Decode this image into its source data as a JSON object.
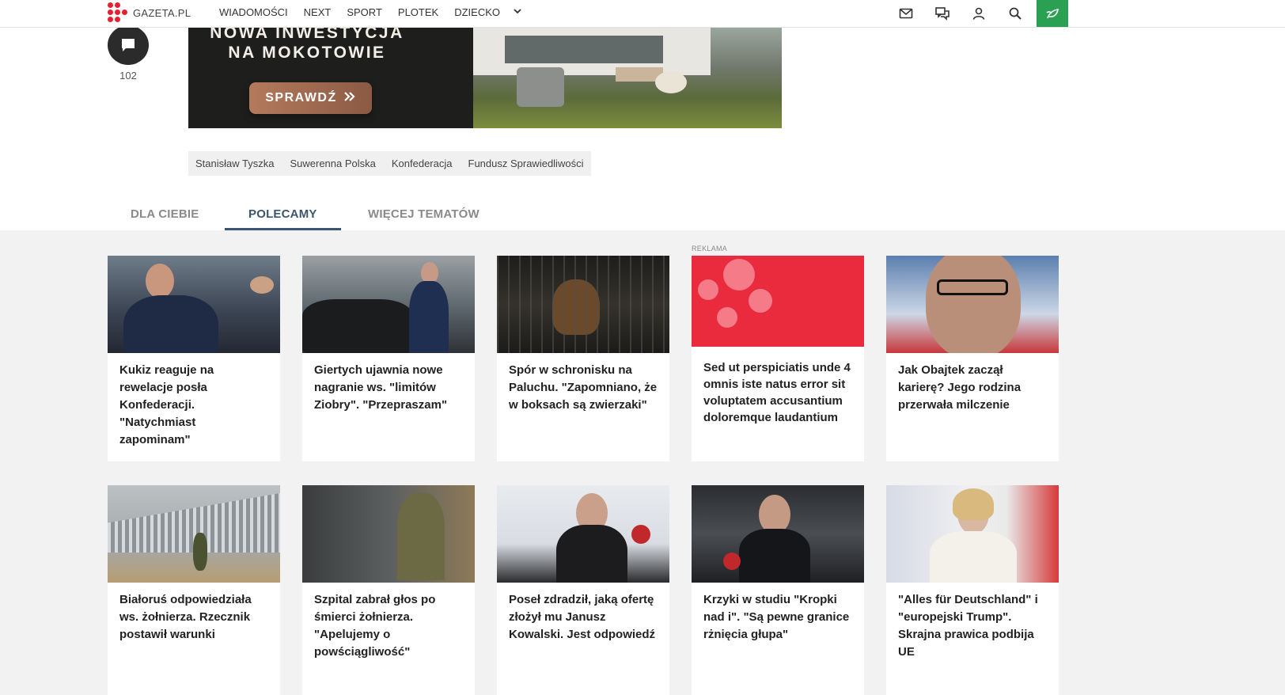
{
  "header": {
    "logo_text": "GAZETA.PL",
    "nav": [
      {
        "label": "WIADOMOŚCI"
      },
      {
        "label": "NEXT"
      },
      {
        "label": "SPORT"
      },
      {
        "label": "PLOTEK"
      },
      {
        "label": "DZIECKO"
      }
    ],
    "more_icon": "chevron-down-icon",
    "tools": [
      "mail-icon",
      "chat-icon",
      "user-icon",
      "search-icon",
      "leaf-icon"
    ],
    "accent_color": "#2aa052",
    "brand_color": "#e5212f"
  },
  "comments": {
    "count": "102",
    "icon": "comment-icon"
  },
  "banner": {
    "title_line1": "NOWA INWESTYCJA",
    "title_line2": "NA MOKOTOWIE",
    "cta": "SPRAWDŹ"
  },
  "tags": [
    "Stanisław Tyszka",
    "Suwerenna Polska",
    "Konfederacja",
    "Fundusz Sprawiedliwości"
  ],
  "tabs": [
    {
      "label": "DLA CIEBIE",
      "active": false
    },
    {
      "label": "POLECAMY",
      "active": true
    },
    {
      "label": "WIĘCEJ TEMATÓW",
      "active": false
    }
  ],
  "ad_label": "REKLAMA",
  "cards": [
    {
      "title": "Kukiz reaguje na rewelacje posła Konfederacji. \"Natychmiast zapominam\""
    },
    {
      "title": "Giertych ujawnia nowe nagranie ws. \"limitów Ziobry\". \"Przepraszam\""
    },
    {
      "title": "Spór w schronisku na Paluchu. \"Zapomniano, że w boksach są zwierzaki\""
    },
    {
      "title": "Sed ut perspiciatis unde 4 omnis iste natus error sit voluptatem accusantium doloremque laudantium"
    },
    {
      "title": "Jak Obajtek zaczął karierę? Jego rodzina przerwała milczenie"
    },
    {
      "title": "Białoruś odpowiedziała ws. żołnierza. Rzecznik postawił warunki"
    },
    {
      "title": "Szpital zabrał głos po śmierci żołnierza. \"Apelujemy o powściągliwość\""
    },
    {
      "title": "Poseł zdradził, jaką ofertę złożył mu Janusz Kowalski. Jest odpowiedź"
    },
    {
      "title": "Krzyki w studiu \"Kropki nad i\". \"Są pewne granice rżnięcia głupa\""
    },
    {
      "title": "\"Alles für Deutschland\" i \"europejski Trump\". Skrajna prawica podbija UE"
    }
  ]
}
